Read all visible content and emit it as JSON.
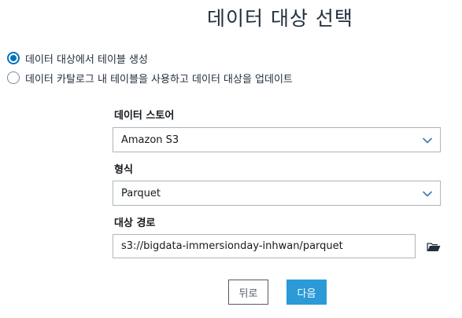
{
  "page": {
    "title": "데이터 대상 선택"
  },
  "target_options": [
    {
      "label": "데이터 대상에서 테이블 생성",
      "selected": true
    },
    {
      "label": "데이터 카탈로그 내 테이블을 사용하고 데이터 대상을 업데이트",
      "selected": false
    }
  ],
  "data_store": {
    "label": "데이터 스토어",
    "value": "Amazon S3",
    "icon": "chevron-down-icon"
  },
  "format": {
    "label": "형식",
    "value": "Parquet",
    "icon": "chevron-down-icon"
  },
  "target_path": {
    "label": "대상 경로",
    "value": "s3://bigdata-immersionday-inhwan/parquet",
    "icon": "folder-open-icon"
  },
  "buttons": {
    "back": "뒤로",
    "next": "다음"
  },
  "colors": {
    "primary": "#2b9ad6",
    "radio_selected": "#0073bb",
    "chevron": "#3a78b5",
    "text": "#16191f"
  }
}
